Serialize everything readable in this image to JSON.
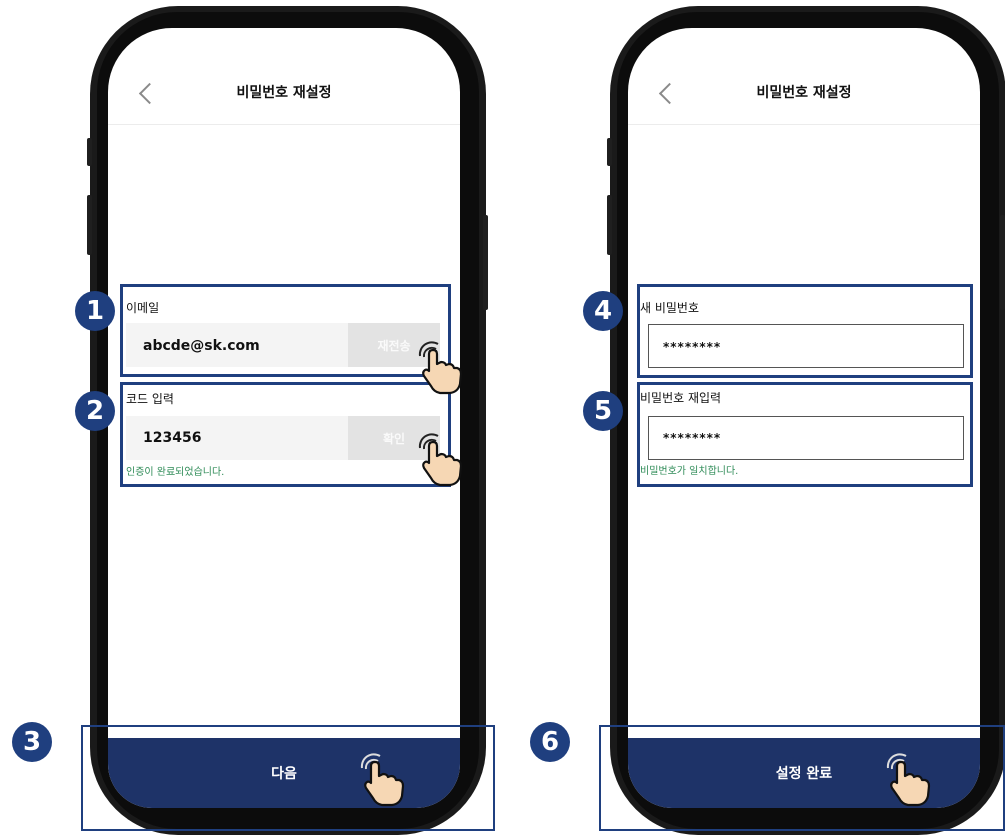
{
  "left_screen": {
    "title": "비밀번호 재설정",
    "email_label": "이메일",
    "email_value": "abcde@sk.com",
    "resend_button": "재전송",
    "code_label": "코드 입력",
    "code_value": "123456",
    "confirm_button": "확인",
    "verify_message": "인증이 완료되었습니다.",
    "next_button": "다음"
  },
  "right_screen": {
    "title": "비밀번호 재설정",
    "new_password_label": "새 비밀번호",
    "new_password_value": "********",
    "reenter_label": "비밀번호 재입력",
    "reenter_value": "********",
    "match_message": "비밀번호가 일치합니다.",
    "complete_button": "설정 완료"
  },
  "steps": [
    "1",
    "2",
    "3",
    "4",
    "5",
    "6"
  ],
  "colors": {
    "accent_navy": "#1e3368",
    "highlight_blue": "#1f3f7f",
    "success_green": "#2e8b57",
    "disabled_grey": "#e3e3e3"
  },
  "icons": [
    "back-chevron-icon",
    "tap-hand-icon"
  ]
}
